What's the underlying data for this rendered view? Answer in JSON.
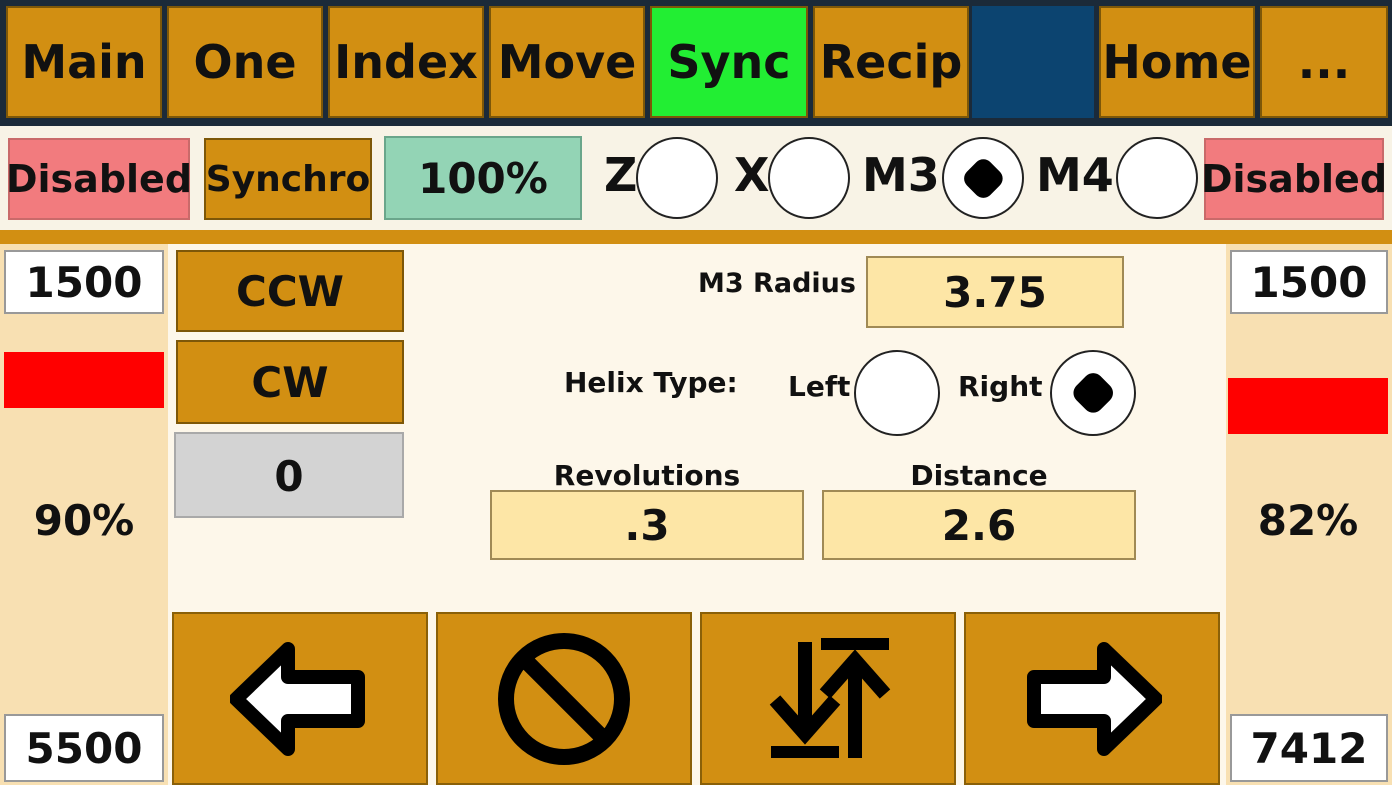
{
  "tabs": [
    {
      "label": "Main"
    },
    {
      "label": "One"
    },
    {
      "label": "Index"
    },
    {
      "label": "Move"
    },
    {
      "label": "Sync",
      "active": true
    },
    {
      "label": "Recip"
    },
    {
      "label": ""
    },
    {
      "label": "Home"
    },
    {
      "label": "..."
    }
  ],
  "status": {
    "left_state": "Disabled",
    "mode": "Synchro",
    "speed_percent": "100%",
    "axes": [
      {
        "label": "Z",
        "selected": false
      },
      {
        "label": "X",
        "selected": false
      },
      {
        "label": "M3",
        "selected": true
      },
      {
        "label": "M4",
        "selected": false
      }
    ],
    "right_state": "Disabled"
  },
  "left_panel": {
    "top_value": "1500",
    "percent": "90%",
    "bottom_value": "5500"
  },
  "right_panel": {
    "top_value": "1500",
    "percent": "82%",
    "bottom_value": "7412"
  },
  "direction": {
    "ccw_label": "CCW",
    "cw_label": "CW",
    "counter": "0"
  },
  "sync": {
    "radius_label": "M3 Radius",
    "radius_value": "3.75",
    "helix_label": "Helix Type:",
    "helix_left_label": "Left",
    "helix_right_label": "Right",
    "helix_selected": "Right",
    "revolutions_label": "Revolutions",
    "revolutions_value": ".3",
    "distance_label": "Distance",
    "distance_value": "2.6"
  },
  "bottom_buttons": [
    {
      "icon": "arrow-left-icon"
    },
    {
      "icon": "stop-icon"
    },
    {
      "icon": "swap-direction-icon"
    },
    {
      "icon": "arrow-right-icon"
    }
  ],
  "colors": {
    "gold": "#d28f12",
    "active_tab": "#22ee33",
    "disabled_pink": "#f27b7e",
    "percent_green": "#93d4b5",
    "input_yellow": "#fde6a6",
    "bar_red": "#ff0000",
    "header_navy": "#1b2a39"
  }
}
